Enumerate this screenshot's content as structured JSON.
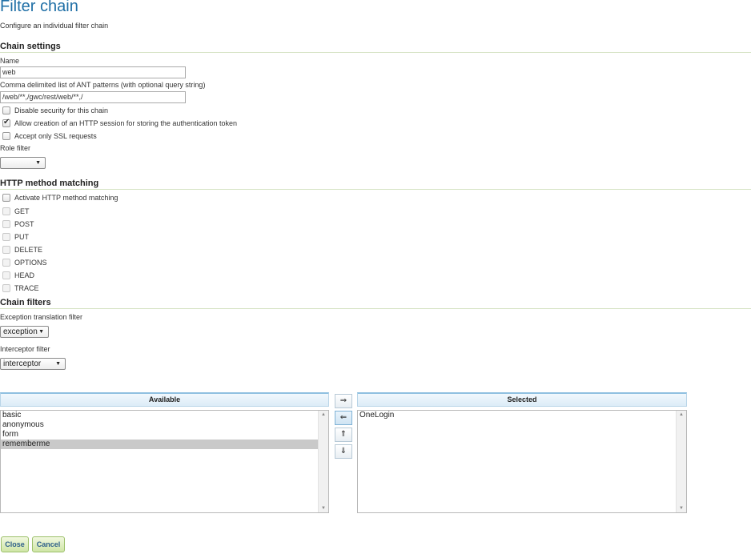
{
  "page": {
    "title": "Filter chain",
    "subtitle": "Configure an individual filter chain"
  },
  "chain_settings": {
    "heading": "Chain settings",
    "name_label": "Name",
    "name_value": "web",
    "patterns_label": "Comma delimited list of ANT patterns (with optional query string)",
    "patterns_value": "/web/**,/gwc/rest/web/**,/",
    "disable_security_label": "Disable security for this chain",
    "disable_security_checked": false,
    "allow_session_label": "Allow creation of an HTTP session for storing the authentication token",
    "allow_session_checked": true,
    "ssl_only_label": "Accept only SSL requests",
    "ssl_only_checked": false,
    "role_filter_label": "Role filter",
    "role_filter_value": ""
  },
  "http_method": {
    "heading": "HTTP method matching",
    "activate_label": "Activate HTTP method matching",
    "activate_checked": false,
    "methods": [
      "GET",
      "POST",
      "PUT",
      "DELETE",
      "OPTIONS",
      "HEAD",
      "TRACE"
    ]
  },
  "chain_filters": {
    "heading": "Chain filters",
    "exception_label": "Exception translation filter",
    "exception_value": "exception",
    "interceptor_label": "Interceptor filter",
    "interceptor_value": "interceptor"
  },
  "palette": {
    "available_header": "Available",
    "selected_header": "Selected",
    "available": [
      "basic",
      "anonymous",
      "form",
      "rememberme"
    ],
    "available_selected_item": "rememberme",
    "selected": [
      "OneLogin"
    ],
    "buttons": {
      "add": "⇒",
      "remove": "⇐",
      "up": "⇑",
      "down": "⇓"
    }
  },
  "footer": {
    "close_label": "Close",
    "cancel_label": "Cancel"
  },
  "colors": {
    "title": "#1f6fa6",
    "button_text": "#2e5f8a",
    "button_bg": "#cfe6a6",
    "list_header_bg": "#dcecf7",
    "list_selection": "#c9c9c9"
  }
}
